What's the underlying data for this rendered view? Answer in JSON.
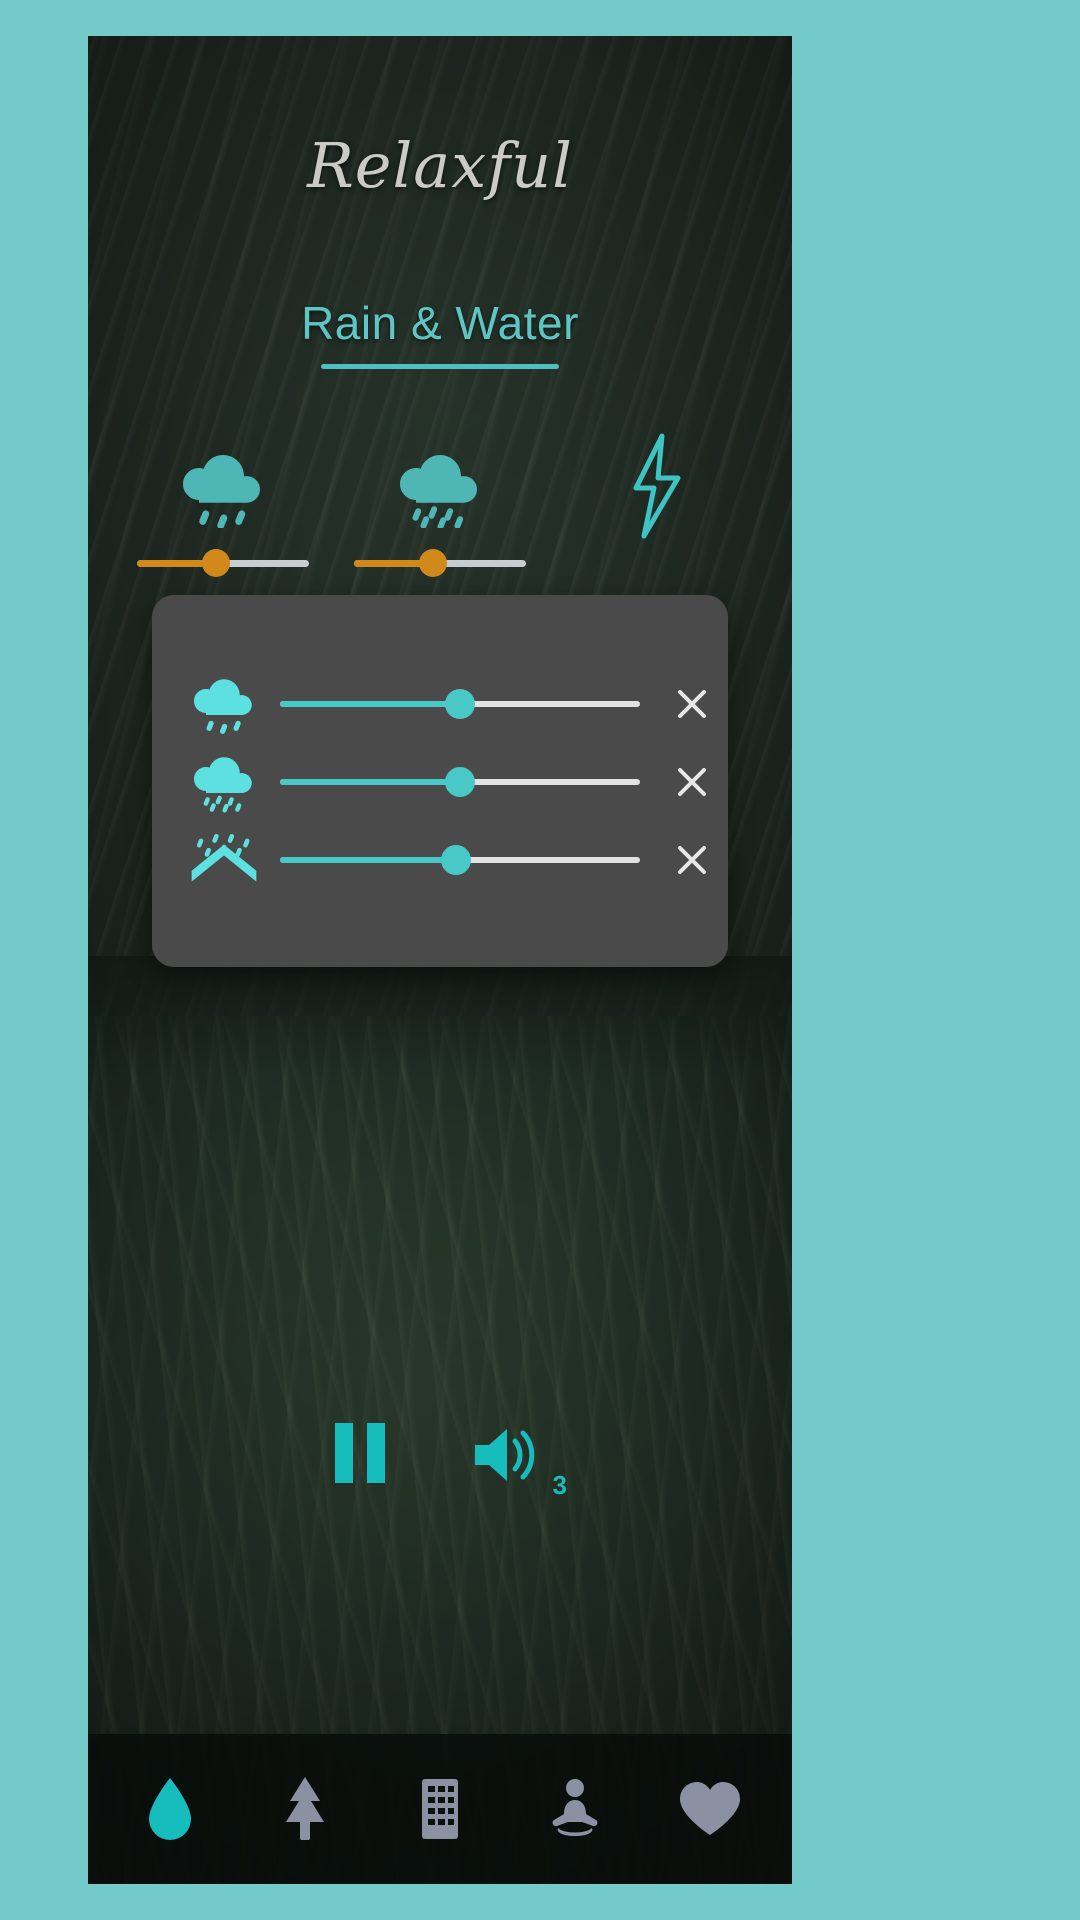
{
  "app": {
    "brand": "Relaxful",
    "accent_teal": "#49c8c8",
    "accent_orange": "#d1891b",
    "panel_bg": "#4a4a4a",
    "page_bg": "#74c9c9"
  },
  "category": {
    "title": "Rain & Water"
  },
  "sound_grid": [
    {
      "icon": "rain-cloud-icon",
      "name": "rain-cloud",
      "slider_value": 46,
      "slider_color": "#d1891b"
    },
    {
      "icon": "rain-cloud-icon",
      "name": "heavy-rain-cloud",
      "slider_value": 46,
      "slider_color": "#d1891b"
    },
    {
      "icon": "lightning-bolt-icon",
      "name": "thunder",
      "slider_value": null,
      "slider_color": null
    }
  ],
  "mixer": {
    "rows": [
      {
        "icon": "rain-cloud-icon",
        "label": "rain-cloud",
        "slider_value": 50,
        "close_label": "×"
      },
      {
        "icon": "rain-cloud-icon",
        "label": "heavy-rain-cloud",
        "slider_value": 50,
        "close_label": "×"
      },
      {
        "icon": "rain-on-roof-icon",
        "label": "rain-on-roof",
        "slider_value": 49,
        "close_label": "×"
      }
    ]
  },
  "player": {
    "pause_label": "Pause",
    "volume_label": "Volume",
    "active_sound_count": "3"
  },
  "bottom_nav": [
    {
      "icon": "water-drop-icon",
      "name": "nav-rain-water",
      "active": true
    },
    {
      "icon": "pine-tree-icon",
      "name": "nav-nature",
      "active": false
    },
    {
      "icon": "building-icon",
      "name": "nav-city",
      "active": false
    },
    {
      "icon": "meditation-icon",
      "name": "nav-meditation",
      "active": false
    },
    {
      "icon": "heart-icon",
      "name": "nav-favorites",
      "active": false
    }
  ]
}
